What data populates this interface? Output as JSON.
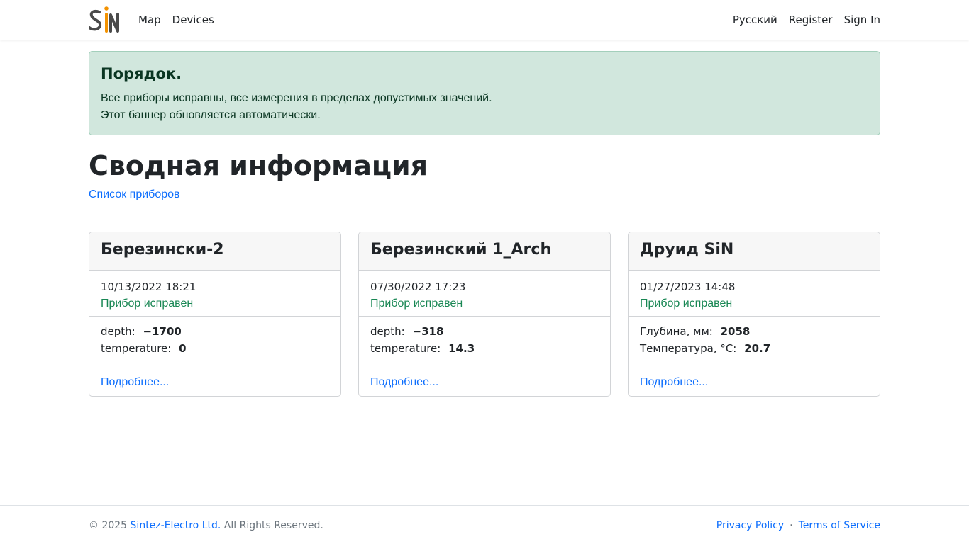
{
  "nav": {
    "logo_text": "SiN",
    "links": [
      "Map",
      "Devices"
    ],
    "language": "Русский",
    "register": "Register",
    "sign_in": "Sign In"
  },
  "alert": {
    "heading": "Порядок.",
    "line1": "Все приборы исправны, все измерения в пределах допустимых значений.",
    "line2": "Этот баннер обновляется автоматически."
  },
  "main": {
    "title": "Сводная информация",
    "devices_link": "Список приборов"
  },
  "cards": [
    {
      "name": "Березински-2",
      "timestamp": "10/13/2022 18:21",
      "status": "Прибор исправен",
      "measurements": [
        {
          "label": "depth:",
          "value": "−1700"
        },
        {
          "label": "temperature:",
          "value": "0"
        }
      ],
      "more": "Подробнее..."
    },
    {
      "name": "Березинский 1_Arch",
      "timestamp": "07/30/2022 17:23",
      "status": "Прибор исправен",
      "measurements": [
        {
          "label": "depth:",
          "value": "−318"
        },
        {
          "label": "temperature:",
          "value": "14.3"
        }
      ],
      "more": "Подробнее..."
    },
    {
      "name": "Друид SiN",
      "timestamp": "01/27/2023 14:48",
      "status": "Прибор исправен",
      "measurements": [
        {
          "label": "Глубина, мм:",
          "value": "2058"
        },
        {
          "label": "Температура, °C:",
          "value": "20.7"
        }
      ],
      "more": "Подробнее..."
    }
  ],
  "footer": {
    "copyright_prefix": "© 2025",
    "company": "Sintez-Electro Ltd.",
    "rights": "All Rights Reserved.",
    "privacy": "Privacy Policy",
    "separator": "·",
    "terms": "Terms of Service"
  },
  "colors": {
    "accent_link": "#0d6efd",
    "success_text": "#198754",
    "alert_bg": "#d1e7dd",
    "logo_orange": "#f39200",
    "logo_gray": "#4a4a4a"
  }
}
